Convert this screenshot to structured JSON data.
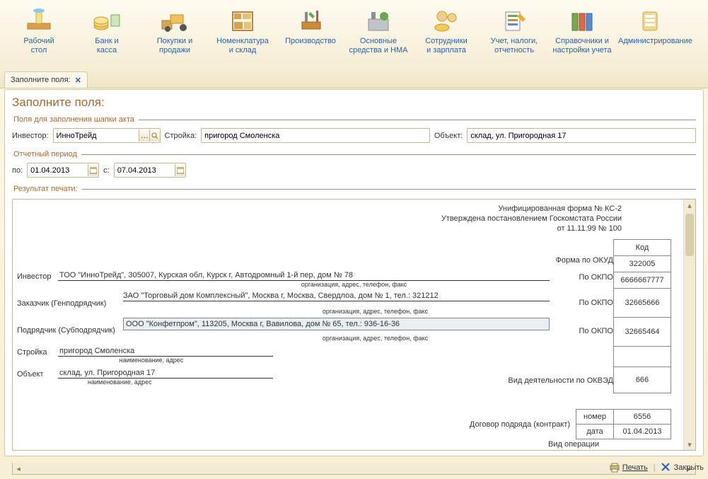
{
  "toolbar": {
    "items": [
      {
        "label": "Рабочий\nстол",
        "icon": "desk"
      },
      {
        "label": "Банк и\nкасса",
        "icon": "coins"
      },
      {
        "label": "Покупки и\nпродажи",
        "icon": "truck"
      },
      {
        "label": "Номенклатура\nи склад",
        "icon": "shelf"
      },
      {
        "label": "Производство",
        "icon": "tools"
      },
      {
        "label": "Основные\nсредства и НМА",
        "icon": "plant"
      },
      {
        "label": "Сотрудники\nи зарплата",
        "icon": "people"
      },
      {
        "label": "Учет, налоги,\nотчетность",
        "icon": "report"
      },
      {
        "label": "Справочники и\nнастройки учета",
        "icon": "binders"
      },
      {
        "label": "Администрирование",
        "icon": "server"
      }
    ]
  },
  "tab": {
    "title": "Заполните поля:"
  },
  "page": {
    "title": "Заполните поля:"
  },
  "groups": {
    "header": "Поля для заполнения шапки акта",
    "period": "Отчетный период",
    "result": "Результат печати:"
  },
  "headerFields": {
    "investor_label": "Инвестор:",
    "investor_value": "ИнноТрейд",
    "stroyka_label": "Стройка:",
    "stroyka_value": "пригород Смоленска",
    "object_label": "Объект:",
    "object_value": "склад, ул. Пригородная 17"
  },
  "period": {
    "from_label": "по:",
    "from_value": "01.04.2013",
    "to_label": "с:",
    "to_value": "07.04.2013"
  },
  "doc": {
    "uni_line1": "Унифицированная форма № КС-2",
    "uni_line2": "Утверждена постановлением  Госкомстата России",
    "uni_line3": "от 11.11.99 № 100",
    "kod_header": "Код",
    "okud_label": "Форма по ОКУД",
    "okud_value": "322005",
    "okpo_label": "По ОКПО",
    "investor_label": "Инвестор",
    "investor_value": "ТОО \"ИнноТрейд\", 305007, Курская обл, Курск г, Автодромный 1-й пер, дом № 78",
    "investor_okpo": "6666667777",
    "org_sub": "организация, адрес, телефон, факс",
    "zakazchik_label": "Заказчик (Генподрядчик)",
    "zakazchik_value": "ЗАО \"Торговый дом Комплексный\", Москва г, Москва, Свердлоа, дом № 1, тел.: 321212",
    "zakazchik_okpo": "32665666",
    "podryadchik_label": "Подрядчик (Субподрядчик)",
    "podryadchik_value": "ООО \"Конфетпром\", 113205, Москва г, Вавилова, дом № 65, тел.: 936-16-36",
    "podryadchik_okpo": "32665464",
    "stroyka_label": "Стройка",
    "stroyka_value": "пригород Смоленска",
    "stroyka_sub": "наименование, адрес",
    "object_label": "Объект",
    "object_value": "склад, ул. Пригородная 17",
    "object_sub": "наименование, адрес",
    "okved_label": "Вид деятельности по ОКВЭД",
    "okved_value": "666",
    "contract_label": "Договор подряда (контракт)",
    "contract_number_label": "номер",
    "contract_number_value": "6556",
    "contract_date_label": "дата",
    "contract_date_value": "01.04.2013",
    "vid_oper": "Вид операции"
  },
  "bottom": {
    "print": "Печать",
    "close": "Закрыть"
  }
}
